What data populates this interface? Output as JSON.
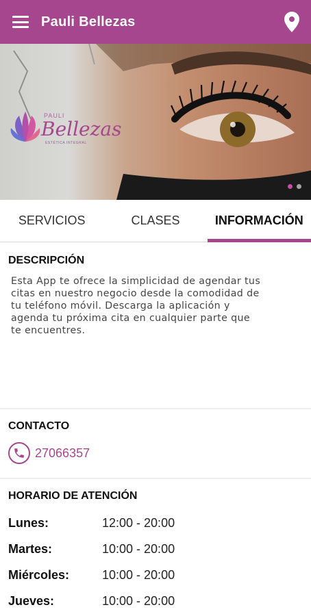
{
  "appbar": {
    "title": "Pauli Bellezas",
    "bg": "#a5468f"
  },
  "hero": {
    "logo_small": "PAULI",
    "logo_script": "Bellezas",
    "logo_tagline": "ESTÉTICA INTEGRAL",
    "slides": 2,
    "active_slide": 1
  },
  "tabs": [
    {
      "label": "SERVICIOS",
      "active": false
    },
    {
      "label": "CLASES",
      "active": false
    },
    {
      "label": "INFORMACIÓN",
      "active": true
    }
  ],
  "description": {
    "title": "DESCRIPCIÓN",
    "lines": [
      "Esta App te ofrece la simplicidad de agendar tus",
      "citas en nuestro negocio desde la comodidad de",
      "tu teléfono móvil. Descarga la aplicación y",
      "agenda tu próxima cita en cualquier parte que",
      "te encuentres."
    ]
  },
  "contact": {
    "title": "CONTACTO",
    "phone": "27066357",
    "icon": "phone-icon"
  },
  "hours": {
    "title": "HORARIO DE ATENCIÓN",
    "rows": [
      {
        "day": "Lunes:",
        "time": "12:00 - 20:00"
      },
      {
        "day": "Martes:",
        "time": "10:00 - 20:00"
      },
      {
        "day": "Miércoles:",
        "time": "10:00 - 20:00"
      },
      {
        "day": "Jueves:",
        "time": "10:00 - 20:00"
      }
    ]
  },
  "colors": {
    "accent": "#a5468f",
    "dot_active": "#c34fa4"
  }
}
